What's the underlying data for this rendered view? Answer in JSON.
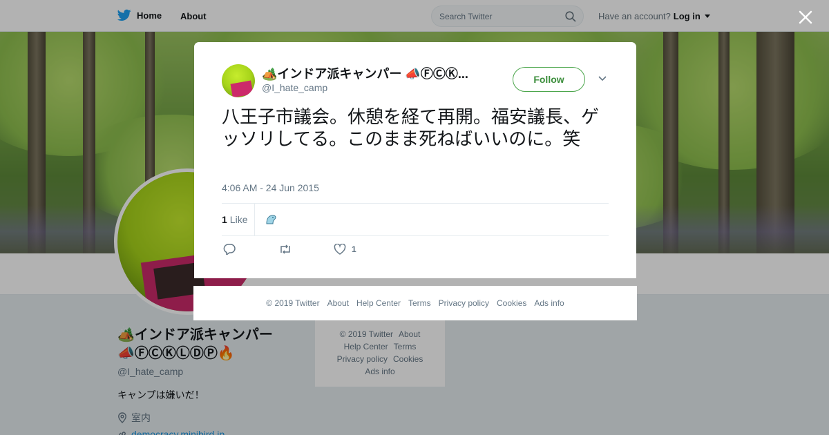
{
  "nav": {
    "home_label": "Home",
    "about_label": "About",
    "search_placeholder": "Search Twitter",
    "account_prompt": "Have an account?",
    "login_label": "Log in"
  },
  "profile": {
    "name_line1": "🏕️インドア派キャンパー",
    "name_line2": "📣ⒻⒸⓀⓁⒹⓅ🔥",
    "handle": "@I_hate_camp",
    "bio": "キャンプは嫌いだ！",
    "location": "室内",
    "url": "democracy.minibird.jp"
  },
  "side_footer": {
    "copyright": "© 2019 Twitter",
    "about": "About",
    "help": "Help Center",
    "terms": "Terms",
    "privacy": "Privacy policy",
    "cookies": "Cookies",
    "ads": "Ads info"
  },
  "tweet": {
    "display_name": "🏕️インドア派キャンパー 📣ⒻⒸⓀ...",
    "handle": "@I_hate_camp",
    "follow_label": "Follow",
    "text": "八王子市議会。休憩を経て再開。福安議長、ゲッソリしてる。このまま死ねばいいのに。笑",
    "timestamp": "4:06 AM - 24 Jun 2015",
    "like_count": "1",
    "like_label": "Like",
    "action_like_count": "1"
  },
  "footer": {
    "copyright": "© 2019 Twitter",
    "about": "About",
    "help": "Help Center",
    "terms": "Terms",
    "privacy": "Privacy policy",
    "cookies": "Cookies",
    "ads": "Ads info"
  },
  "colors": {
    "twitter_blue": "#1da1f2",
    "follow_green": "#4ca64c",
    "muted": "#657786"
  }
}
